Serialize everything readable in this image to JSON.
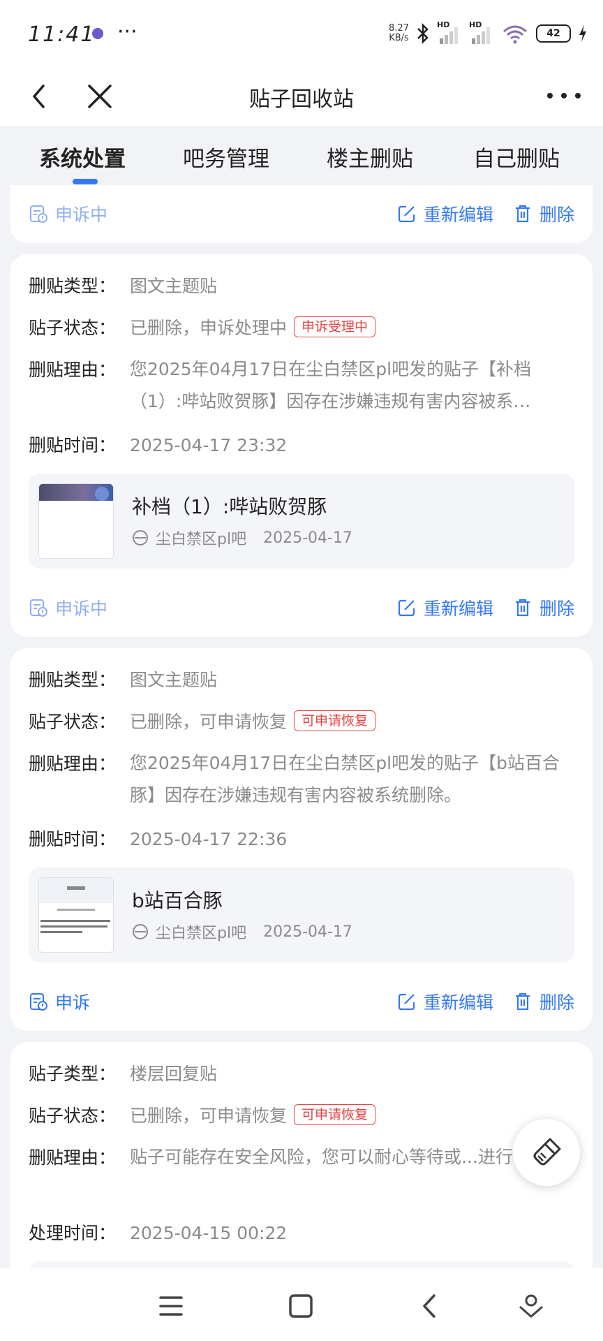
{
  "status_bar": {
    "time": "11:41",
    "more": "···",
    "net_speed_value": "8.27",
    "net_speed_unit": "KB/s",
    "signal1": "HD",
    "signal2": "HD",
    "battery": "42"
  },
  "header": {
    "title": "贴子回收站"
  },
  "tabs": [
    {
      "label": "系统处置",
      "active": true
    },
    {
      "label": "吧务管理"
    },
    {
      "label": "楼主删贴"
    },
    {
      "label": "自己删贴"
    }
  ],
  "colors": {
    "accent": "#3478f6",
    "badge_red": "#e64242",
    "muted_blue": "#8fb0f0"
  },
  "card0": {
    "appeal": "申诉中",
    "reedit": "重新编辑",
    "delete": "删除"
  },
  "card1": {
    "type_label": "删贴类型：",
    "type_value": "图文主题贴",
    "status_label": "贴子状态：",
    "status_value": "已删除，申诉处理中",
    "badge": "申诉受理中",
    "reason_label": "删贴理由：",
    "reason_value": "您2025年04月17日在尘白禁区pl吧发的贴子【补档（1）:哔站败贺豚】因存在涉嫌违规有害内容被系…",
    "time_label": "删贴时间：",
    "time_value": "2025-04-17 23:32",
    "post_title": "补档（1）:哔站败贺豚",
    "forum": "尘白禁区pl吧",
    "post_date": "2025-04-17",
    "appeal": "申诉中",
    "reedit": "重新编辑",
    "delete": "删除"
  },
  "card2": {
    "type_label": "删贴类型：",
    "type_value": "图文主题贴",
    "status_label": "贴子状态：",
    "status_value": "已删除，可申请恢复",
    "badge": "可申请恢复",
    "reason_label": "删贴理由：",
    "reason_value": "您2025年04月17日在尘白禁区pl吧发的贴子【b站百合豚】因存在涉嫌违规有害内容被系统删除。",
    "time_label": "删贴时间：",
    "time_value": "2025-04-17 22:36",
    "post_title": "b站百合豚",
    "forum": "尘白禁区pl吧",
    "post_date": "2025-04-17",
    "appeal": "申诉",
    "reedit": "重新编辑",
    "delete": "删除"
  },
  "card3": {
    "type_label": "贴子类型：",
    "type_value": "楼层回复贴",
    "status_label": "贴子状态：",
    "status_value": "已删除，可申请恢复",
    "badge": "可申请恢复",
    "reason_label": "删贴理由：",
    "reason_value": "贴子可能存在安全风险，您可以耐心等待或...进行申诉",
    "time_label": "处理时间：",
    "time_value": "2025-04-15 00:22"
  }
}
